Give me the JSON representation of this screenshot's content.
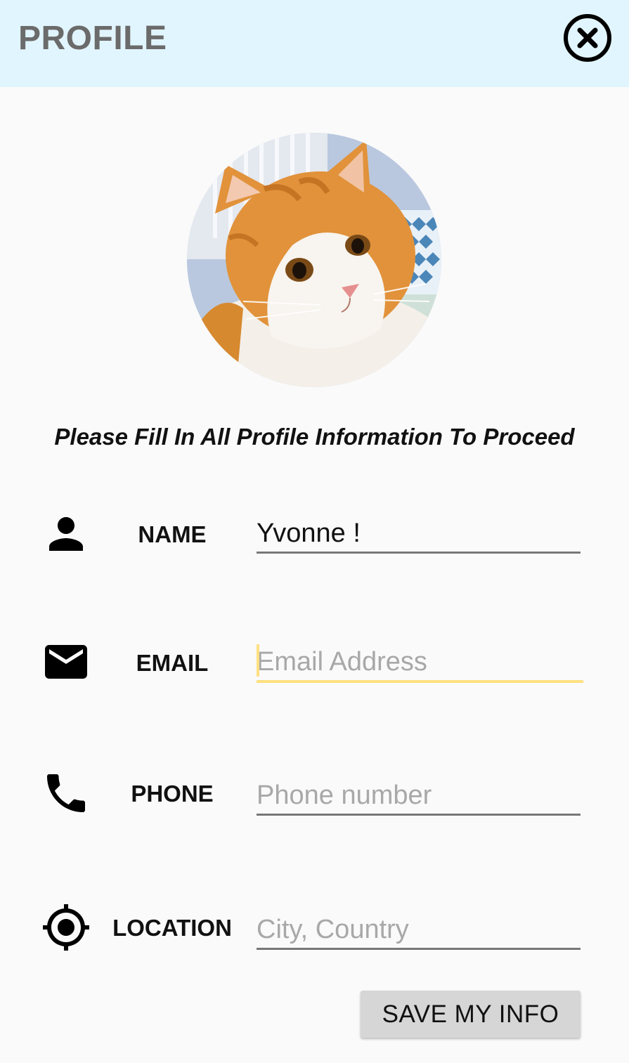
{
  "header": {
    "title": "PROFILE",
    "close_icon": "close-circle-icon"
  },
  "avatar": {
    "icon": "cat-photo"
  },
  "instruction": "Please Fill In All Profile Information To Proceed",
  "fields": {
    "name": {
      "label": "NAME",
      "value": "Yvonne !",
      "placeholder": "",
      "icon": "person-icon"
    },
    "email": {
      "label": "EMAIL",
      "value": "",
      "placeholder": "Email Address",
      "icon": "mail-icon",
      "focused": true
    },
    "phone": {
      "label": "PHONE",
      "value": "",
      "placeholder": "Phone number",
      "icon": "phone-icon"
    },
    "location": {
      "label": "LOCATION",
      "value": "",
      "placeholder": "City, Country",
      "icon": "location-target-icon"
    }
  },
  "save_button": {
    "label": "SAVE MY INFO"
  },
  "colors": {
    "header_bg": "#e1f5fe",
    "focus_accent": "#ffe082",
    "button_bg": "#d6d6d6"
  }
}
